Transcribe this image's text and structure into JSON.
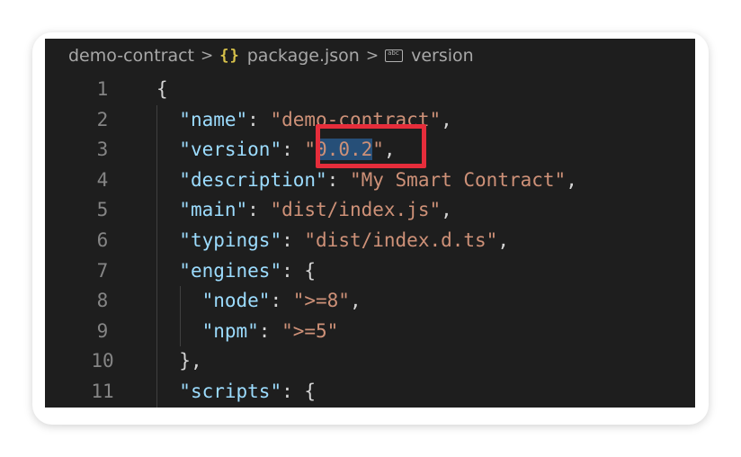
{
  "breadcrumb": {
    "folder": "demo-contract",
    "separator": ">",
    "json_icon": "{}",
    "file": "package.json",
    "symbol": "version"
  },
  "lines": [
    {
      "num": "1",
      "indent": "",
      "tokens": [
        {
          "t": "p",
          "v": "{"
        }
      ]
    },
    {
      "num": "2",
      "indent": "  ",
      "tokens": [
        {
          "t": "k",
          "v": "\"name\""
        },
        {
          "t": "p",
          "v": ": "
        },
        {
          "t": "s",
          "v": "\"demo-contract\""
        },
        {
          "t": "p",
          "v": ","
        }
      ]
    },
    {
      "num": "3",
      "indent": "  ",
      "tokens": [
        {
          "t": "k",
          "v": "\"version\""
        },
        {
          "t": "p",
          "v": ": "
        },
        {
          "t": "s",
          "v": "\""
        },
        {
          "t": "sel",
          "v": "0.0.2"
        },
        {
          "t": "s",
          "v": "\""
        },
        {
          "t": "p",
          "v": ","
        }
      ]
    },
    {
      "num": "4",
      "indent": "  ",
      "tokens": [
        {
          "t": "k",
          "v": "\"description\""
        },
        {
          "t": "p",
          "v": ": "
        },
        {
          "t": "s",
          "v": "\"My Smart Contract\""
        },
        {
          "t": "p",
          "v": ","
        }
      ]
    },
    {
      "num": "5",
      "indent": "  ",
      "tokens": [
        {
          "t": "k",
          "v": "\"main\""
        },
        {
          "t": "p",
          "v": ": "
        },
        {
          "t": "s",
          "v": "\"dist/index.js\""
        },
        {
          "t": "p",
          "v": ","
        }
      ]
    },
    {
      "num": "6",
      "indent": "  ",
      "tokens": [
        {
          "t": "k",
          "v": "\"typings\""
        },
        {
          "t": "p",
          "v": ": "
        },
        {
          "t": "s",
          "v": "\"dist/index.d.ts\""
        },
        {
          "t": "p",
          "v": ","
        }
      ]
    },
    {
      "num": "7",
      "indent": "  ",
      "tokens": [
        {
          "t": "k",
          "v": "\"engines\""
        },
        {
          "t": "p",
          "v": ": {"
        }
      ]
    },
    {
      "num": "8",
      "indent": "    ",
      "tokens": [
        {
          "t": "k",
          "v": "\"node\""
        },
        {
          "t": "p",
          "v": ": "
        },
        {
          "t": "s",
          "v": "\">=8\""
        },
        {
          "t": "p",
          "v": ","
        }
      ]
    },
    {
      "num": "9",
      "indent": "    ",
      "tokens": [
        {
          "t": "k",
          "v": "\"npm\""
        },
        {
          "t": "p",
          "v": ": "
        },
        {
          "t": "s",
          "v": "\">=5\""
        }
      ]
    },
    {
      "num": "10",
      "indent": "  ",
      "tokens": [
        {
          "t": "p",
          "v": "},"
        }
      ]
    },
    {
      "num": "11",
      "indent": "  ",
      "tokens": [
        {
          "t": "k",
          "v": "\"scripts\""
        },
        {
          "t": "p",
          "v": ": {"
        }
      ]
    }
  ],
  "selected_value": "0.0.2",
  "colors": {
    "background": "#1e1e1e",
    "key": "#9cdcfe",
    "string": "#ce9178",
    "selection": "#264f78",
    "annotation_box": "#e62d3b"
  }
}
